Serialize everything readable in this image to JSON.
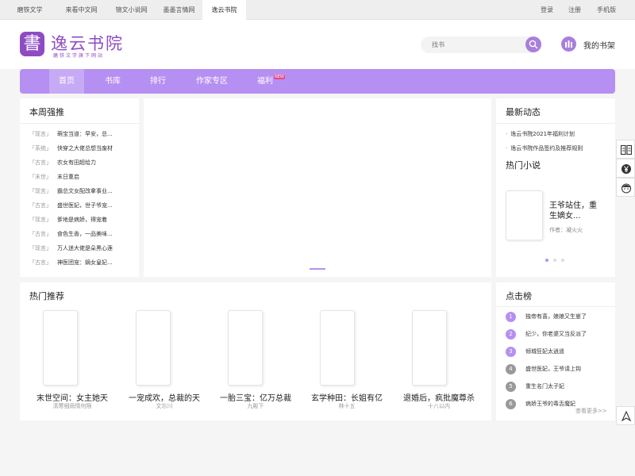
{
  "topbar": {
    "sites": [
      "磨铁文学",
      "来看中文网",
      "锦文小说网",
      "墨墨言情网",
      "逸云书院"
    ],
    "links": [
      "登录",
      "注册",
      "手机版"
    ]
  },
  "header": {
    "logo_glyph": "書",
    "logo_text": "逸云书院",
    "logo_sub": "磨铁文学旗下网站",
    "search_placeholder": "找书",
    "shelf_label": "我的书架"
  },
  "nav": {
    "items": [
      "首页",
      "书库",
      "排行",
      "作家专区",
      "福利"
    ],
    "new_badge": "NEW"
  },
  "week": {
    "title": "本周强推",
    "items": [
      {
        "tag": "「现言」",
        "title": "萌宝当道：早安，总..."
      },
      {
        "tag": "「系统」",
        "title": "快穿之大佬总想当废材"
      },
      {
        "tag": "「古言」",
        "title": "农女有田超给力"
      },
      {
        "tag": "「末世」",
        "title": "末日重启"
      },
      {
        "tag": "「现言」",
        "title": "霸总文女配改拿事业..."
      },
      {
        "tag": "「古言」",
        "title": "盛世医妃，世子爷宠..."
      },
      {
        "tag": "「现言」",
        "title": "爹地是病娇，得宠着"
      },
      {
        "tag": "「古言」",
        "title": "食色生香，一品美味..."
      },
      {
        "tag": "「现言」",
        "title": "万人迷大佬是朵黑心莲"
      },
      {
        "tag": "「古言」",
        "title": "神医团宠：嫡女皇妃..."
      }
    ]
  },
  "news": {
    "title": "最新动态",
    "items": [
      "逸云书院2021年福利计划",
      "逸云书院作品签约及推荐规则"
    ]
  },
  "hot_novel": {
    "title": "热门小说",
    "book_title": "王爷站住，重生嫡女...",
    "author": "作者：凝火火"
  },
  "recommend": {
    "title": "热门推荐",
    "books": [
      {
        "title": "末世空间：女主她天",
        "author": "清寒细雨情何限"
      },
      {
        "title": "一宠成欢，总裁的天",
        "author": "文忘川"
      },
      {
        "title": "一胎三宝：亿万总裁",
        "author": "九殿下"
      },
      {
        "title": "玄学种田：长姐有亿",
        "author": "林十五"
      },
      {
        "title": "退婚后，疯批魔尊杀",
        "author": "十八以内"
      }
    ]
  },
  "ranking": {
    "title": "点击榜",
    "items": [
      {
        "num": "1",
        "title": "独帝有喜，娘娘又生崽了"
      },
      {
        "num": "2",
        "title": "纪少，你老婆又当反派了"
      },
      {
        "num": "3",
        "title": "倾城狂妃太逍遥"
      },
      {
        "num": "4",
        "title": "盛世医妃，王爷请上钩"
      },
      {
        "num": "5",
        "title": "重生名门太子妃"
      },
      {
        "num": "6",
        "title": "病娇王爷的毒舌魔妃"
      }
    ],
    "see_more": "查看更多>>",
    "top_color": "#b68ff2",
    "rest_color": "#999999"
  },
  "colors": {
    "accent": "#b68ff2",
    "brand": "#8f4bc4"
  }
}
